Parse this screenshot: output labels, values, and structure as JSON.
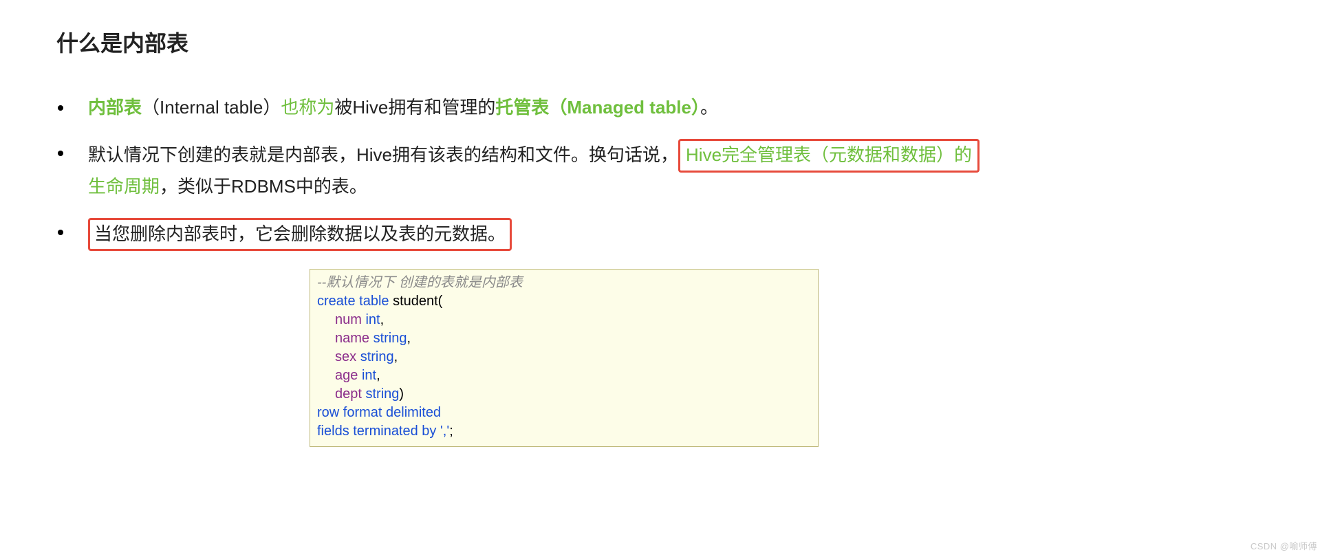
{
  "heading": "什么是内部表",
  "bullets": {
    "b1": {
      "p1_green_bold": "内部表",
      "p2": "（Internal table）",
      "p3_green": "也称为",
      "p4": "被Hive拥有和管理的",
      "p5_green_bold": "托管表（Managed table）",
      "p6": "。"
    },
    "b2": {
      "p1": "默认情况下创建的表就是内部表，Hive拥有该表的结构和文件。换句话说，",
      "p2_green_box": "Hive完全管理表（元数据和数据）的",
      "p3_green": "生命周期",
      "p4": "，类似于RDBMS中的表。"
    },
    "b3": {
      "box": "当您删除内部表时，它会删除数据以及表的元数据。"
    }
  },
  "code": {
    "comment": "--默认情况下 创建的表就是内部表",
    "l2_kw": "create table ",
    "l2_ident": "student(",
    "l3_col": "num ",
    "l3_type": "int",
    "l3_comma": ",",
    "l4_col": "name ",
    "l4_type": "string",
    "l4_comma": ",",
    "l5_col": "sex ",
    "l5_type": "string",
    "l5_comma": ",",
    "l6_col": "age ",
    "l6_type": "int",
    "l6_comma": ",",
    "l7_col": "dept ",
    "l7_type": "string",
    "l7_paren": ")",
    "l8_kw": "row format delimited",
    "l9_kw1": "fields terminated by ",
    "l9_str": "','",
    "l9_semi": ";"
  },
  "watermark": "CSDN @喻师傅"
}
